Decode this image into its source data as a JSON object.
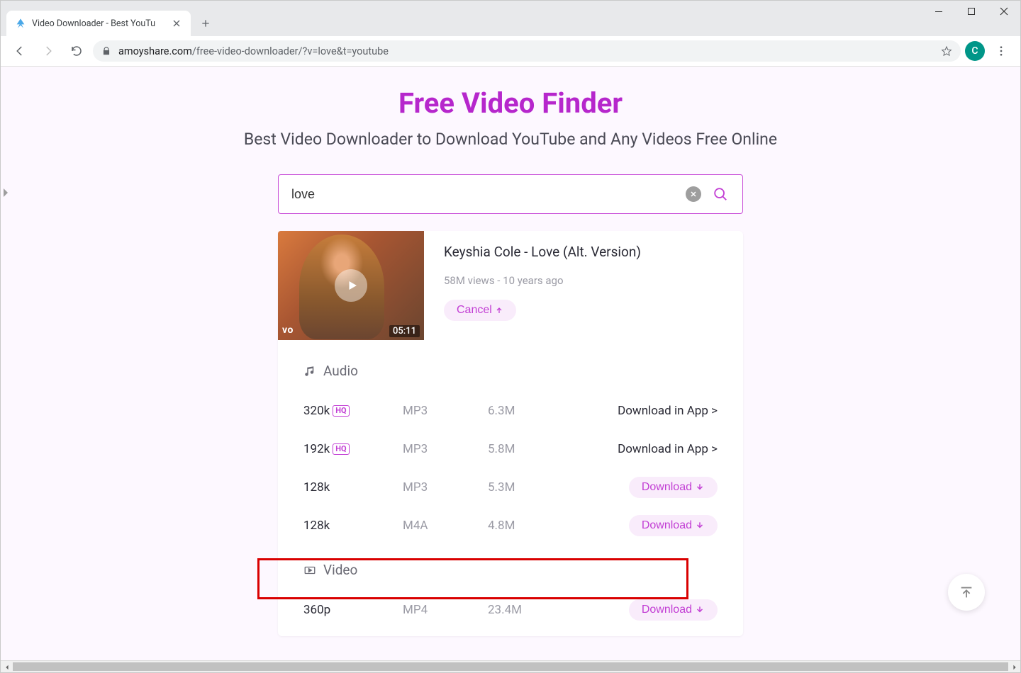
{
  "window": {
    "tab_title": "Video Downloader - Best YouTu",
    "url_domain": "amoyshare.com",
    "url_path": "/free-video-downloader/?v=love&t=youtube",
    "avatar_letter": "C"
  },
  "hero": {
    "title": "Free Video Finder",
    "subtitle": "Best Video Downloader to Download YouTube and Any Videos Free Online"
  },
  "search": {
    "value": "love"
  },
  "result": {
    "title": "Keyshia Cole - Love (Alt. Version)",
    "meta": "58M views - 10 years ago",
    "duration": "05:11",
    "vevo": "vo",
    "cancel_label": "Cancel"
  },
  "sections": {
    "audio_label": "Audio",
    "video_label": "Video",
    "hq_badge": "HQ",
    "download_app": "Download in App >",
    "download_label": "Download"
  },
  "audio": [
    {
      "quality": "320k",
      "hq": true,
      "format": "MP3",
      "size": "6.3M",
      "action": "app"
    },
    {
      "quality": "192k",
      "hq": true,
      "format": "MP3",
      "size": "5.8M",
      "action": "app"
    },
    {
      "quality": "128k",
      "hq": false,
      "format": "MP3",
      "size": "5.3M",
      "action": "download"
    },
    {
      "quality": "128k",
      "hq": false,
      "format": "M4A",
      "size": "4.8M",
      "action": "download"
    }
  ],
  "video": [
    {
      "quality": "360p",
      "format": "MP4",
      "size": "23.4M",
      "action": "download"
    }
  ]
}
